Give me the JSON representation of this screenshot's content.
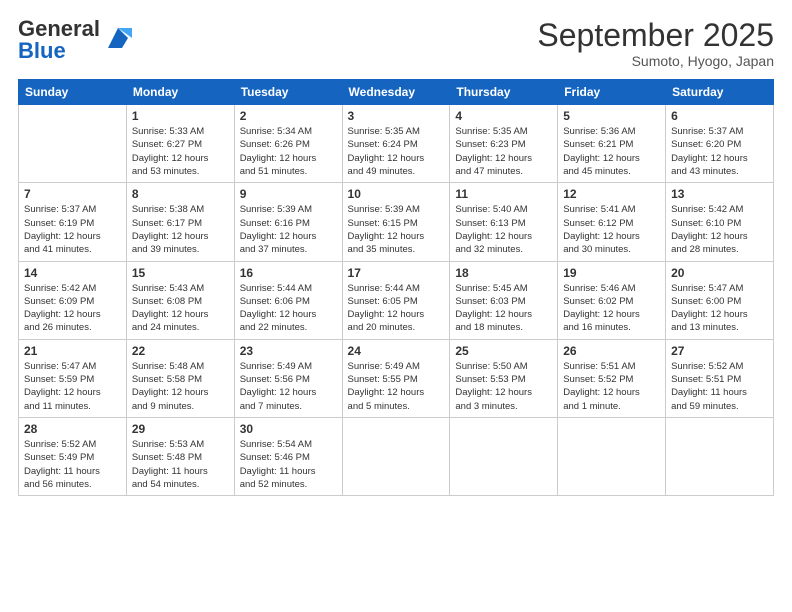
{
  "header": {
    "logo_general": "General",
    "logo_blue": "Blue",
    "month_title": "September 2025",
    "location": "Sumoto, Hyogo, Japan"
  },
  "weekdays": [
    "Sunday",
    "Monday",
    "Tuesday",
    "Wednesday",
    "Thursday",
    "Friday",
    "Saturday"
  ],
  "weeks": [
    [
      {
        "day": "",
        "info": ""
      },
      {
        "day": "1",
        "info": "Sunrise: 5:33 AM\nSunset: 6:27 PM\nDaylight: 12 hours\nand 53 minutes."
      },
      {
        "day": "2",
        "info": "Sunrise: 5:34 AM\nSunset: 6:26 PM\nDaylight: 12 hours\nand 51 minutes."
      },
      {
        "day": "3",
        "info": "Sunrise: 5:35 AM\nSunset: 6:24 PM\nDaylight: 12 hours\nand 49 minutes."
      },
      {
        "day": "4",
        "info": "Sunrise: 5:35 AM\nSunset: 6:23 PM\nDaylight: 12 hours\nand 47 minutes."
      },
      {
        "day": "5",
        "info": "Sunrise: 5:36 AM\nSunset: 6:21 PM\nDaylight: 12 hours\nand 45 minutes."
      },
      {
        "day": "6",
        "info": "Sunrise: 5:37 AM\nSunset: 6:20 PM\nDaylight: 12 hours\nand 43 minutes."
      }
    ],
    [
      {
        "day": "7",
        "info": "Sunrise: 5:37 AM\nSunset: 6:19 PM\nDaylight: 12 hours\nand 41 minutes."
      },
      {
        "day": "8",
        "info": "Sunrise: 5:38 AM\nSunset: 6:17 PM\nDaylight: 12 hours\nand 39 minutes."
      },
      {
        "day": "9",
        "info": "Sunrise: 5:39 AM\nSunset: 6:16 PM\nDaylight: 12 hours\nand 37 minutes."
      },
      {
        "day": "10",
        "info": "Sunrise: 5:39 AM\nSunset: 6:15 PM\nDaylight: 12 hours\nand 35 minutes."
      },
      {
        "day": "11",
        "info": "Sunrise: 5:40 AM\nSunset: 6:13 PM\nDaylight: 12 hours\nand 32 minutes."
      },
      {
        "day": "12",
        "info": "Sunrise: 5:41 AM\nSunset: 6:12 PM\nDaylight: 12 hours\nand 30 minutes."
      },
      {
        "day": "13",
        "info": "Sunrise: 5:42 AM\nSunset: 6:10 PM\nDaylight: 12 hours\nand 28 minutes."
      }
    ],
    [
      {
        "day": "14",
        "info": "Sunrise: 5:42 AM\nSunset: 6:09 PM\nDaylight: 12 hours\nand 26 minutes."
      },
      {
        "day": "15",
        "info": "Sunrise: 5:43 AM\nSunset: 6:08 PM\nDaylight: 12 hours\nand 24 minutes."
      },
      {
        "day": "16",
        "info": "Sunrise: 5:44 AM\nSunset: 6:06 PM\nDaylight: 12 hours\nand 22 minutes."
      },
      {
        "day": "17",
        "info": "Sunrise: 5:44 AM\nSunset: 6:05 PM\nDaylight: 12 hours\nand 20 minutes."
      },
      {
        "day": "18",
        "info": "Sunrise: 5:45 AM\nSunset: 6:03 PM\nDaylight: 12 hours\nand 18 minutes."
      },
      {
        "day": "19",
        "info": "Sunrise: 5:46 AM\nSunset: 6:02 PM\nDaylight: 12 hours\nand 16 minutes."
      },
      {
        "day": "20",
        "info": "Sunrise: 5:47 AM\nSunset: 6:00 PM\nDaylight: 12 hours\nand 13 minutes."
      }
    ],
    [
      {
        "day": "21",
        "info": "Sunrise: 5:47 AM\nSunset: 5:59 PM\nDaylight: 12 hours\nand 11 minutes."
      },
      {
        "day": "22",
        "info": "Sunrise: 5:48 AM\nSunset: 5:58 PM\nDaylight: 12 hours\nand 9 minutes."
      },
      {
        "day": "23",
        "info": "Sunrise: 5:49 AM\nSunset: 5:56 PM\nDaylight: 12 hours\nand 7 minutes."
      },
      {
        "day": "24",
        "info": "Sunrise: 5:49 AM\nSunset: 5:55 PM\nDaylight: 12 hours\nand 5 minutes."
      },
      {
        "day": "25",
        "info": "Sunrise: 5:50 AM\nSunset: 5:53 PM\nDaylight: 12 hours\nand 3 minutes."
      },
      {
        "day": "26",
        "info": "Sunrise: 5:51 AM\nSunset: 5:52 PM\nDaylight: 12 hours\nand 1 minute."
      },
      {
        "day": "27",
        "info": "Sunrise: 5:52 AM\nSunset: 5:51 PM\nDaylight: 11 hours\nand 59 minutes."
      }
    ],
    [
      {
        "day": "28",
        "info": "Sunrise: 5:52 AM\nSunset: 5:49 PM\nDaylight: 11 hours\nand 56 minutes."
      },
      {
        "day": "29",
        "info": "Sunrise: 5:53 AM\nSunset: 5:48 PM\nDaylight: 11 hours\nand 54 minutes."
      },
      {
        "day": "30",
        "info": "Sunrise: 5:54 AM\nSunset: 5:46 PM\nDaylight: 11 hours\nand 52 minutes."
      },
      {
        "day": "",
        "info": ""
      },
      {
        "day": "",
        "info": ""
      },
      {
        "day": "",
        "info": ""
      },
      {
        "day": "",
        "info": ""
      }
    ]
  ]
}
